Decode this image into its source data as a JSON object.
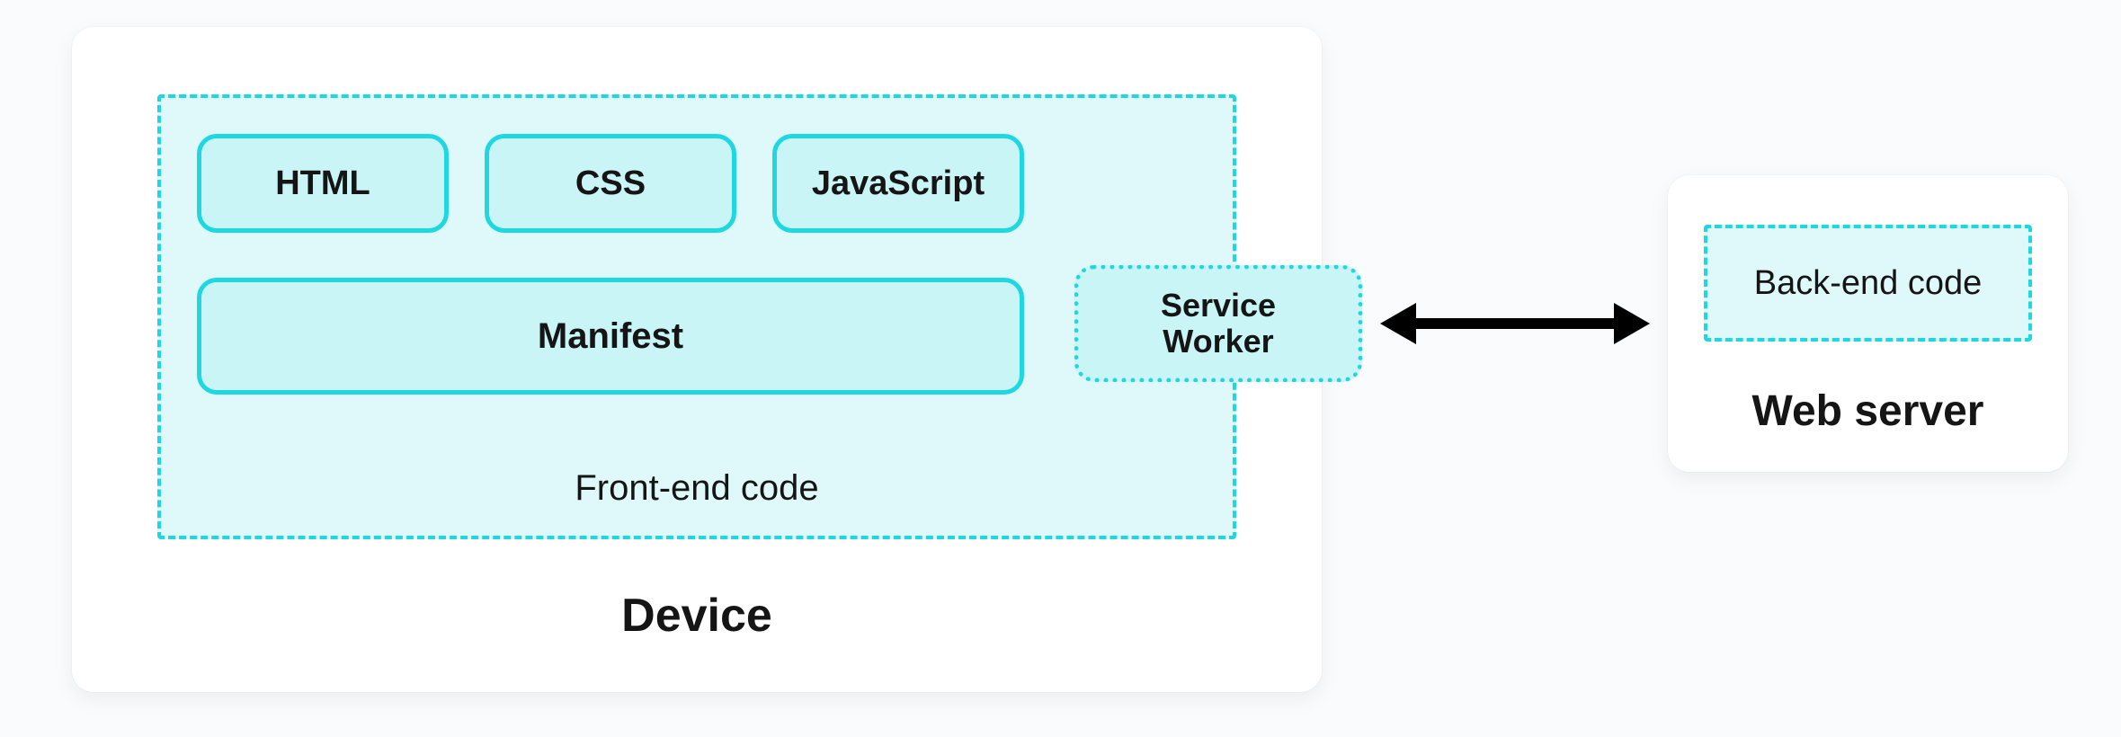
{
  "device": {
    "title": "Device",
    "frontend_label": "Front-end code",
    "tech": {
      "html": "HTML",
      "css": "CSS",
      "js": "JavaScript"
    },
    "manifest": "Manifest",
    "service_worker_line1": "Service",
    "service_worker_line2": "Worker"
  },
  "server": {
    "title": "Web server",
    "backend_label": "Back-end code"
  }
}
